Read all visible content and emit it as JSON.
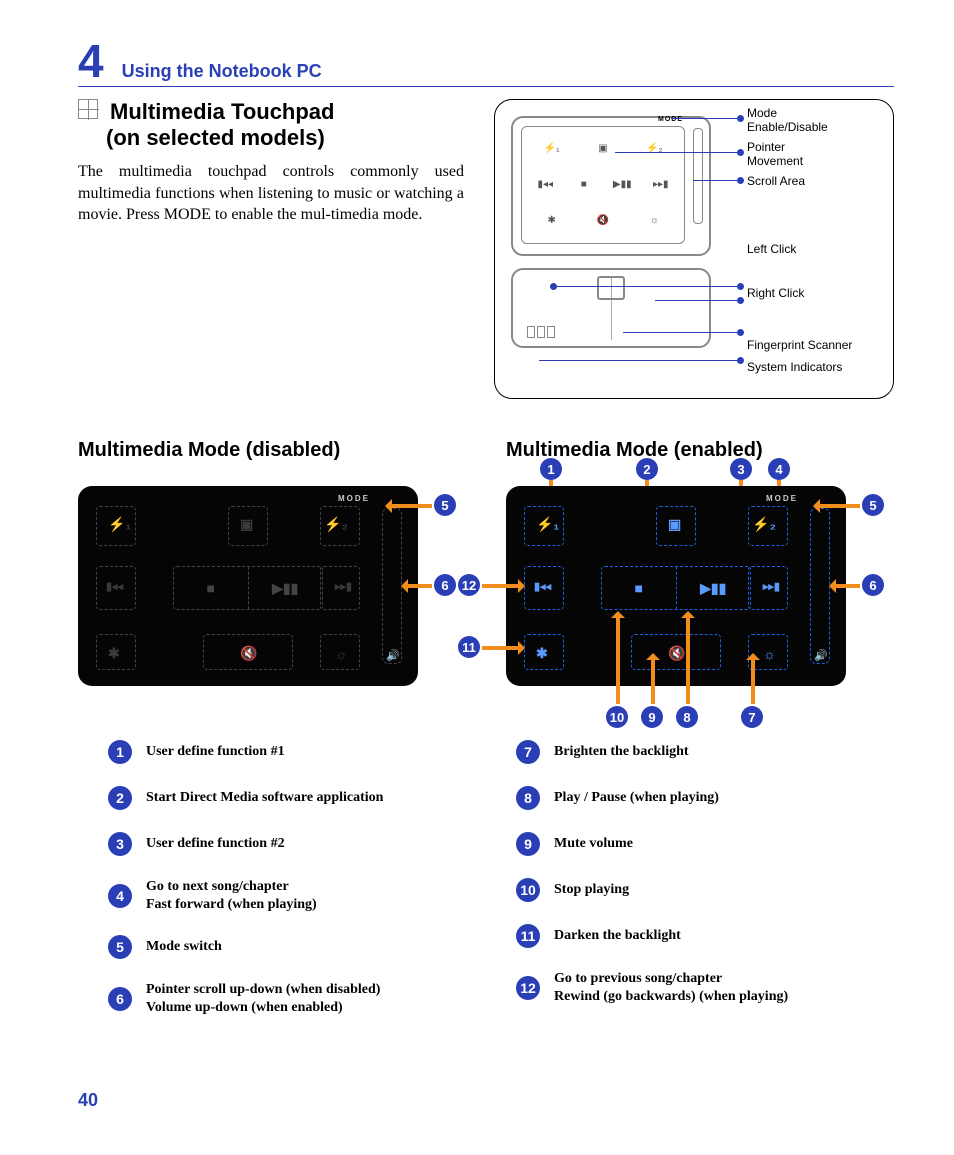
{
  "chapter": {
    "number": "4",
    "title": "Using the Notebook PC"
  },
  "section": {
    "heading_line1": "Multimedia Touchpad",
    "heading_line2": "(on selected models)",
    "body": "The multimedia touchpad controls commonly used multimedia functions when listening to music or watching a movie. Press MODE to enable the mul-timedia mode."
  },
  "schematic_labels": {
    "mode": "Mode\nEnable/Disable",
    "pointer": "Pointer\nMovement",
    "scroll": "Scroll Area",
    "left": "Left Click",
    "right": "Right Click",
    "fp": "Fingerprint Scanner",
    "sys": "System Indicators",
    "mode_tag": "MODE"
  },
  "modes": {
    "disabled_h": "Multimedia Mode (disabled)",
    "enabled_h": "Multimedia Mode (enabled)",
    "mode_tag": "MODE"
  },
  "touchpad_glyphs": {
    "f1": "⚡₁",
    "media": "▣",
    "f2": "⚡₂",
    "prev": "▮◂◂",
    "stop": "■",
    "play": "▶▮▮",
    "next": "▸▸▮",
    "dark": "✱",
    "mute": "🔇",
    "bright": "☼",
    "vol": "🔊"
  },
  "legend": {
    "left": [
      {
        "n": "1",
        "t": "User define function #1"
      },
      {
        "n": "2",
        "t": "Start Direct Media software application"
      },
      {
        "n": "3",
        "t": "User define function #2"
      },
      {
        "n": "4",
        "t": "Go to next song/chapter\nFast forward (when playing)"
      },
      {
        "n": "5",
        "t": "Mode switch"
      },
      {
        "n": "6",
        "t": "Pointer scroll up-down (when disabled)\nVolume up-down (when enabled)"
      }
    ],
    "right": [
      {
        "n": "7",
        "t": "Brighten the backlight"
      },
      {
        "n": "8",
        "t": "Play / Pause (when playing)"
      },
      {
        "n": "9",
        "t": "Mute volume"
      },
      {
        "n": "10",
        "t": "Stop playing"
      },
      {
        "n": "11",
        "t": "Darken the backlight"
      },
      {
        "n": "12",
        "t": "Go to previous song/chapter\nRewind (go backwards) (when playing)"
      }
    ]
  },
  "page_number": "40"
}
